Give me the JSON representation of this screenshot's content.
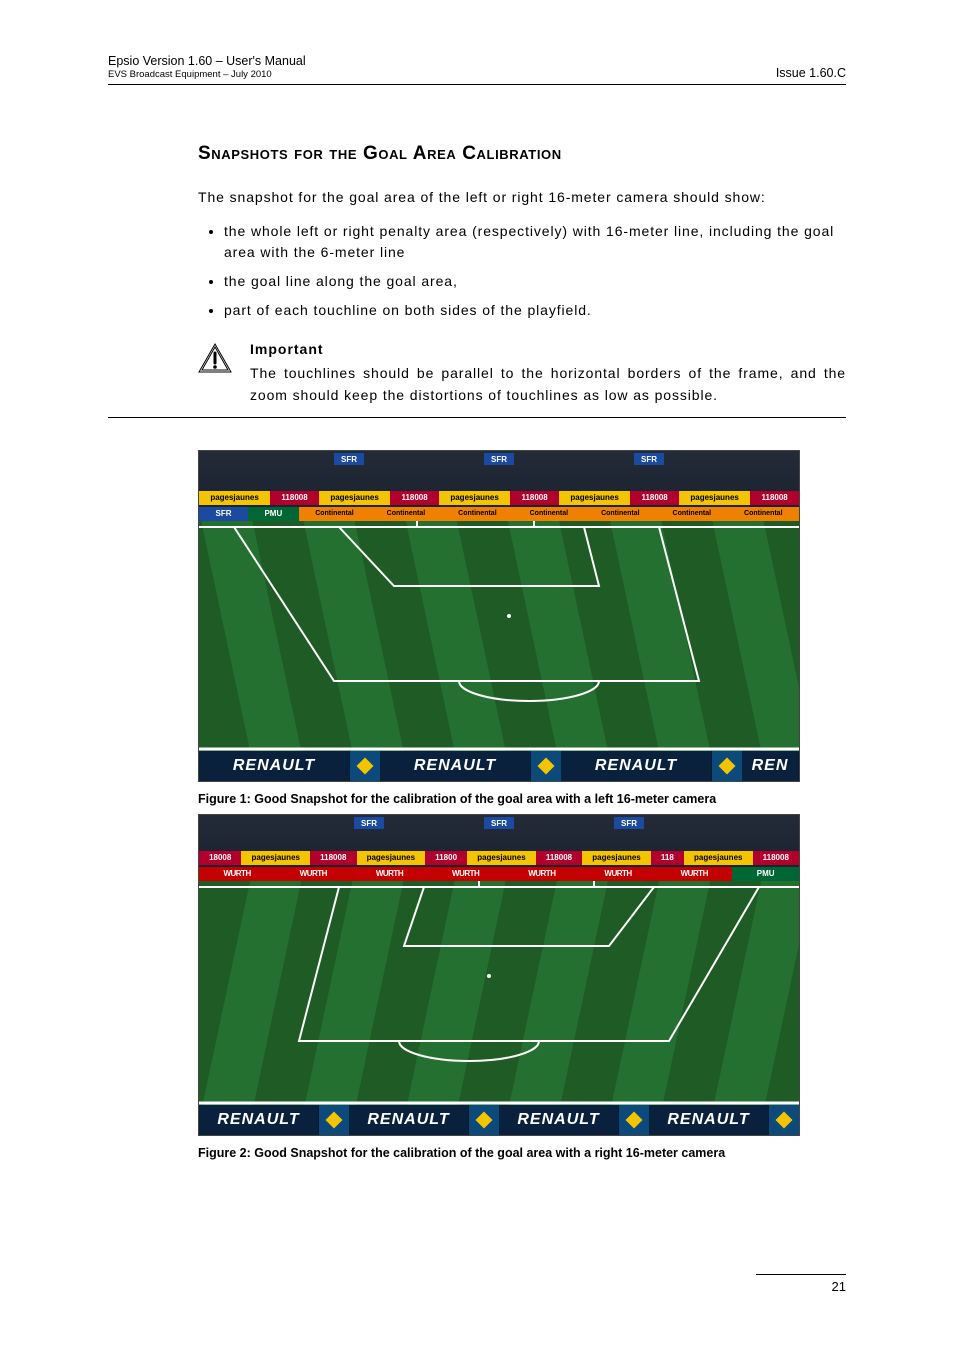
{
  "header": {
    "product_line": "Epsio Version 1.60 – User's Manual",
    "sub_line": "EVS Broadcast Equipment – July 2010",
    "issue": "Issue 1.60.C"
  },
  "section": {
    "title": "Snapshots for the Goal Area Calibration",
    "intro": "The snapshot for the goal area of the left or right 16-meter camera should show:",
    "bullets": [
      "the whole left or right penalty area (respectively) with 16-meter line, including the goal area with the 6-meter line",
      "the goal line along the goal area,",
      "part of each touchline on both sides of the playfield."
    ]
  },
  "callout": {
    "label": "Important",
    "text": "The touchlines should be parallel to the horizontal borders of the frame, and the zoom should keep the distortions of touchlines as low as possible."
  },
  "figures": {
    "fig1": {
      "caption": "Figure 1: Good Snapshot for the calibration of the goal area with a left 16-meter camera",
      "sponsors_top_row1": [
        "SFR",
        "SFR",
        "SFR"
      ],
      "sponsors_top_row2": [
        "pagesjaunes",
        "118008",
        "pagesjaunes",
        "118008",
        "pagesjaunes",
        "118008",
        "pagesjaunes",
        "118008",
        "pagesjaunes",
        "118008"
      ],
      "sponsors_top_row3": [
        "SFR",
        "PMU",
        "Continental",
        "Continental",
        "Continental",
        "Continental",
        "Continental",
        "Continental",
        "Continental"
      ],
      "bottom_board": [
        "RENAULT",
        "RENAULT",
        "RENAULT",
        "REN"
      ]
    },
    "fig2": {
      "caption": "Figure 2: Good Snapshot for the calibration of the goal area with a right 16-meter camera",
      "sponsors_top_row1": [
        "SFR",
        "SFR",
        "SFR"
      ],
      "sponsors_top_row2": [
        "18008",
        "pagesjaunes",
        "118008",
        "pagesjaunes",
        "11800",
        "pagesjaunes",
        "118008",
        "pagesjaunes",
        "118",
        "pagesjaunes",
        "118008"
      ],
      "sponsors_top_row3": [
        "WURTH",
        "WURTH",
        "WURTH",
        "WURTH",
        "WURTH",
        "WURTH",
        "WURTH",
        "PMU"
      ],
      "bottom_board": [
        "RENAULT",
        "RENAULT",
        "RENAULT",
        "RENAULT"
      ]
    }
  },
  "page_number": "21"
}
